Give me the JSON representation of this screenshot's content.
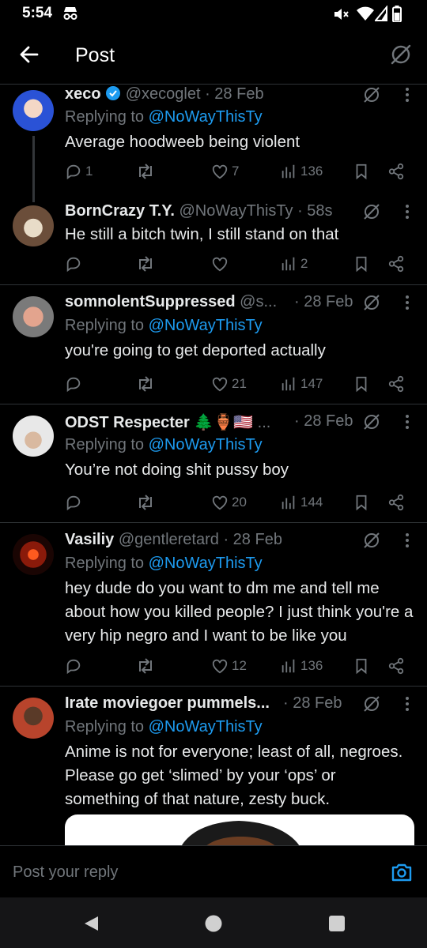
{
  "status": {
    "time": "5:54"
  },
  "header": {
    "title": "Post"
  },
  "replies": [
    {
      "name": "xeco",
      "handle": "@xecoglet",
      "date": "· 28 Feb",
      "replying_prefix": "Replying to",
      "replying_to": "@NoWayThisTy",
      "text": "Average hoodweeb being violent",
      "comments": "1",
      "reposts": "",
      "likes": "7",
      "views": "136"
    },
    {
      "name": "BornCrazy T.Y.",
      "handle": "@NoWayThisTy",
      "date": "· 58s",
      "text": "He still a bitch twin, I still stand on that",
      "comments": "",
      "reposts": "",
      "likes": "",
      "views": "2"
    },
    {
      "name": "somnolentSuppressed",
      "handle": "@s...",
      "date": "· 28 Feb",
      "replying_prefix": "Replying to",
      "replying_to": "@NoWayThisTy",
      "text": "you're going to get deported actually",
      "comments": "",
      "reposts": "",
      "likes": "21",
      "views": "147"
    },
    {
      "name": "ODST Respecter 🌲🏺🇺🇸",
      "handle": "...",
      "date": "· 28 Feb",
      "replying_prefix": "Replying to",
      "replying_to": "@NoWayThisTy",
      "text": "You’re not doing shit pussy boy",
      "comments": "",
      "reposts": "",
      "likes": "20",
      "views": "144"
    },
    {
      "name": "Vasiliy",
      "handle": "@gentleretard",
      "date": "· 28 Feb",
      "replying_prefix": "Replying to",
      "replying_to": "@NoWayThisTy",
      "text": "hey dude do you want to dm me and tell me about how you killed people? I just think you're a very hip negro and I want to be like you",
      "comments": "",
      "reposts": "",
      "likes": "12",
      "views": "136"
    },
    {
      "name": "Irate moviegoer pummels...",
      "handle": "",
      "date": "· 28 Feb",
      "replying_prefix": "Replying to",
      "replying_to": "@NoWayThisTy",
      "text": "Anime is not for everyone; least of all, negroes. Please go get ‘slimed’ by your ‘ops’ or something of that nature, zesty buck."
    }
  ],
  "reply_bar": {
    "placeholder": "Post your reply"
  },
  "colors": {
    "background": "#000000",
    "accent": "#1d9bf0",
    "muted": "#71767b",
    "verified": "#1d9bf0"
  }
}
